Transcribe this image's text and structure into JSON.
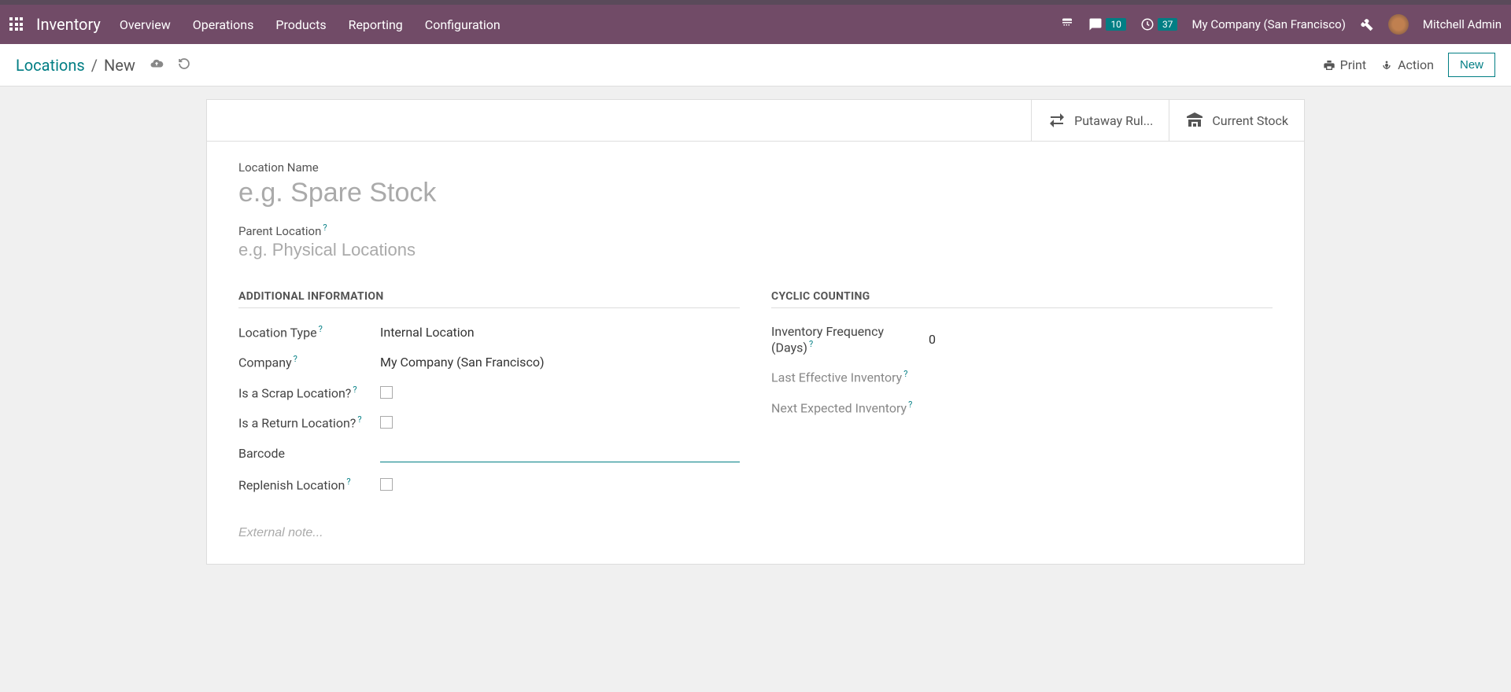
{
  "nav": {
    "brand": "Inventory",
    "menu": [
      "Overview",
      "Operations",
      "Products",
      "Reporting",
      "Configuration"
    ],
    "msg_badge": "10",
    "activity_badge": "37",
    "company": "My Company (San Francisco)",
    "user": "Mitchell Admin"
  },
  "control": {
    "breadcrumb_root": "Locations",
    "breadcrumb_current": "New",
    "print": "Print",
    "action": "Action",
    "new_btn": "New"
  },
  "statbtns": {
    "putaway": "Putaway Rul...",
    "stock": "Current Stock"
  },
  "form": {
    "name_label": "Location Name",
    "name_placeholder": "e.g. Spare Stock",
    "parent_label": "Parent Location",
    "parent_placeholder": "e.g. Physical Locations",
    "section_additional": "ADDITIONAL INFORMATION",
    "section_cyclic": "CYCLIC COUNTING",
    "location_type_label": "Location Type",
    "location_type_value": "Internal Location",
    "company_label": "Company",
    "company_value": "My Company (San Francisco)",
    "scrap_label": "Is a Scrap Location?",
    "return_label": "Is a Return Location?",
    "barcode_label": "Barcode",
    "replenish_label": "Replenish Location",
    "inv_freq_label": "Inventory Frequency (Days)",
    "inv_freq_value": "0",
    "last_inv_label": "Last Effective Inventory",
    "next_inv_label": "Next Expected Inventory",
    "note_placeholder": "External note..."
  }
}
